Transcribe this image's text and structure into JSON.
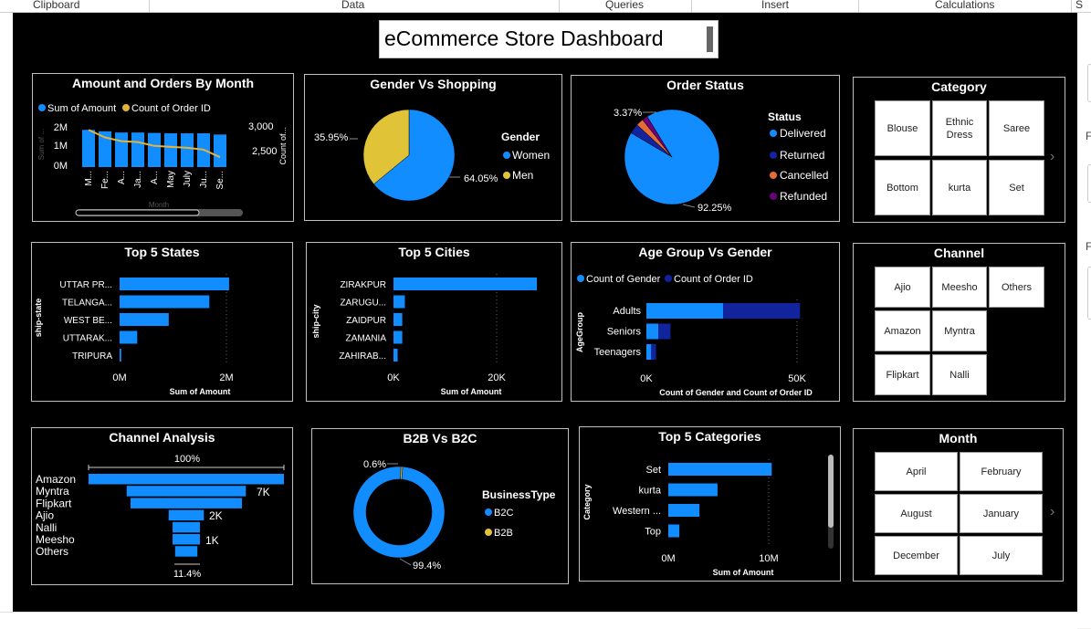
{
  "ribbon": {
    "groups": [
      "Clipboard",
      "Data",
      "Queries",
      "Insert",
      "Calculations",
      "S"
    ]
  },
  "side_labels": [
    "F",
    "F"
  ],
  "dashboard": {
    "title": "eCommerce Store Dashboard"
  },
  "amount_orders": {
    "title": "Amount and Orders By Month",
    "legend": [
      "Sum of Amount",
      "Count of Order ID"
    ],
    "y_left_ticks": [
      "2M",
      "1M",
      "0M"
    ],
    "y_right_ticks": [
      "3,000",
      "2,500"
    ],
    "y_left_label": "Sum of ...",
    "y_right_label": "Count of...",
    "x_label": "Month",
    "month_labels": [
      "M...",
      "Fe...",
      "A...",
      "Ja...",
      "A...",
      "May",
      "July",
      "Ju...",
      "Se..."
    ],
    "bar_values": [
      1.85,
      1.78,
      1.72,
      1.72,
      1.7,
      1.68,
      1.68,
      1.68,
      1.62
    ],
    "line_values": [
      2930,
      2850,
      2810,
      2800,
      2760,
      2750,
      2740,
      2720,
      2640
    ],
    "y_left_max": 2,
    "y_right_range": [
      2400,
      3000
    ],
    "colors": {
      "bar": "#118dff",
      "line": "#e1b53b"
    }
  },
  "gender_shopping": {
    "title": "Gender Vs Shopping",
    "legend_title": "Gender",
    "legend": [
      "Women",
      "Men"
    ],
    "values": [
      64.05,
      35.95
    ],
    "labels": [
      "64.05%",
      "35.95%"
    ],
    "colors": [
      "#118dff",
      "#e1c338"
    ]
  },
  "order_status": {
    "title": "Order Status",
    "legend_title": "Status",
    "legend": [
      "Delivered",
      "Returned",
      "Cancelled",
      "Refunded"
    ],
    "values": [
      92.25,
      3.37,
      2.5,
      1.88
    ],
    "labels": [
      "92.25%",
      "3.37%"
    ],
    "colors": [
      "#118dff",
      "#12239e",
      "#e66c37",
      "#6b007b"
    ]
  },
  "category": {
    "title": "Category",
    "items": [
      "Blouse",
      "Ethnic Dress",
      "Saree",
      "Bottom",
      "kurta",
      "Set"
    ],
    "more_icon": "chevron-right-icon"
  },
  "top_states": {
    "title": "Top 5 States",
    "categories": [
      "UTTAR PR...",
      "TELANGA...",
      "WEST BE...",
      "UTTARAK...",
      "TRIPURA"
    ],
    "values": [
      2.05,
      1.68,
      0.92,
      0.33,
      0.03
    ],
    "x_ticks": [
      "0M",
      "2M"
    ],
    "x_max": 2.0,
    "xlabel": "Sum of Amount",
    "ylabel": "ship-state"
  },
  "top_cities": {
    "title": "Top 5 Cities",
    "categories": [
      "ZIRAKPUR",
      "ZARUGU...",
      "ZAIDPUR",
      "ZAMANIA",
      "ZAHIRAB..."
    ],
    "values": [
      27800,
      2200,
      1700,
      1700,
      800
    ],
    "x_ticks": [
      "0K",
      "20K"
    ],
    "x_max": 20000,
    "xlabel": "Sum of Amount",
    "ylabel": "ship-city"
  },
  "age_gender": {
    "title": "Age Group Vs Gender",
    "legend": [
      "Count of Gender",
      "Count of Order ID"
    ],
    "categories": [
      "Adults",
      "Seniors",
      "Teenagers"
    ],
    "series": [
      {
        "name": "Count of Gender",
        "values": [
          25500,
          4000,
          1600
        ]
      },
      {
        "name": "Count of Order ID",
        "values": [
          25500,
          4000,
          1600
        ]
      }
    ],
    "x_ticks": [
      "0K",
      "50K"
    ],
    "x_max": 50000,
    "xlabel": "Count of Gender and Count of Order ID",
    "ylabel": "AgeGroup",
    "colors": [
      "#118dff",
      "#12239e"
    ]
  },
  "channel_slicer": {
    "title": "Channel",
    "items": [
      "Ajio",
      "Meesho",
      "Others",
      "Amazon",
      "Myntra",
      "Flipkart",
      "Nalli"
    ]
  },
  "channel_analysis": {
    "title": "Channel Analysis",
    "categories": [
      "Amazon",
      "Myntra",
      "Flipkart",
      "Ajio",
      "Nalli",
      "Meesho",
      "Others"
    ],
    "values": [
      100,
      61,
      57,
      18,
      14,
      14,
      11.4
    ],
    "value_labels": [
      "7K",
      "2K",
      "1K"
    ],
    "top_label": "100%",
    "bottom_label": "11.4%"
  },
  "b2b_b2c": {
    "title": "B2B Vs B2C",
    "legend_title": "BusinessType",
    "legend": [
      "B2C",
      "B2B"
    ],
    "values": [
      99.4,
      0.6
    ],
    "labels": [
      "99.4%",
      "0.6%"
    ],
    "colors": [
      "#118dff",
      "#e1c338"
    ]
  },
  "top_categories": {
    "title": "Top 5 Categories",
    "categories": [
      "Set",
      "kurta",
      "Western ...",
      "Top"
    ],
    "values": [
      10300000,
      4900000,
      3100000,
      1100000
    ],
    "x_ticks": [
      "0M",
      "10M"
    ],
    "x_max": 10000000,
    "xlabel": "Sum of Amount",
    "ylabel": "Category"
  },
  "month_slicer": {
    "title": "Month",
    "items": [
      "April",
      "February",
      "August",
      "January",
      "December",
      "July"
    ],
    "more_icon": "chevron-right-icon"
  }
}
